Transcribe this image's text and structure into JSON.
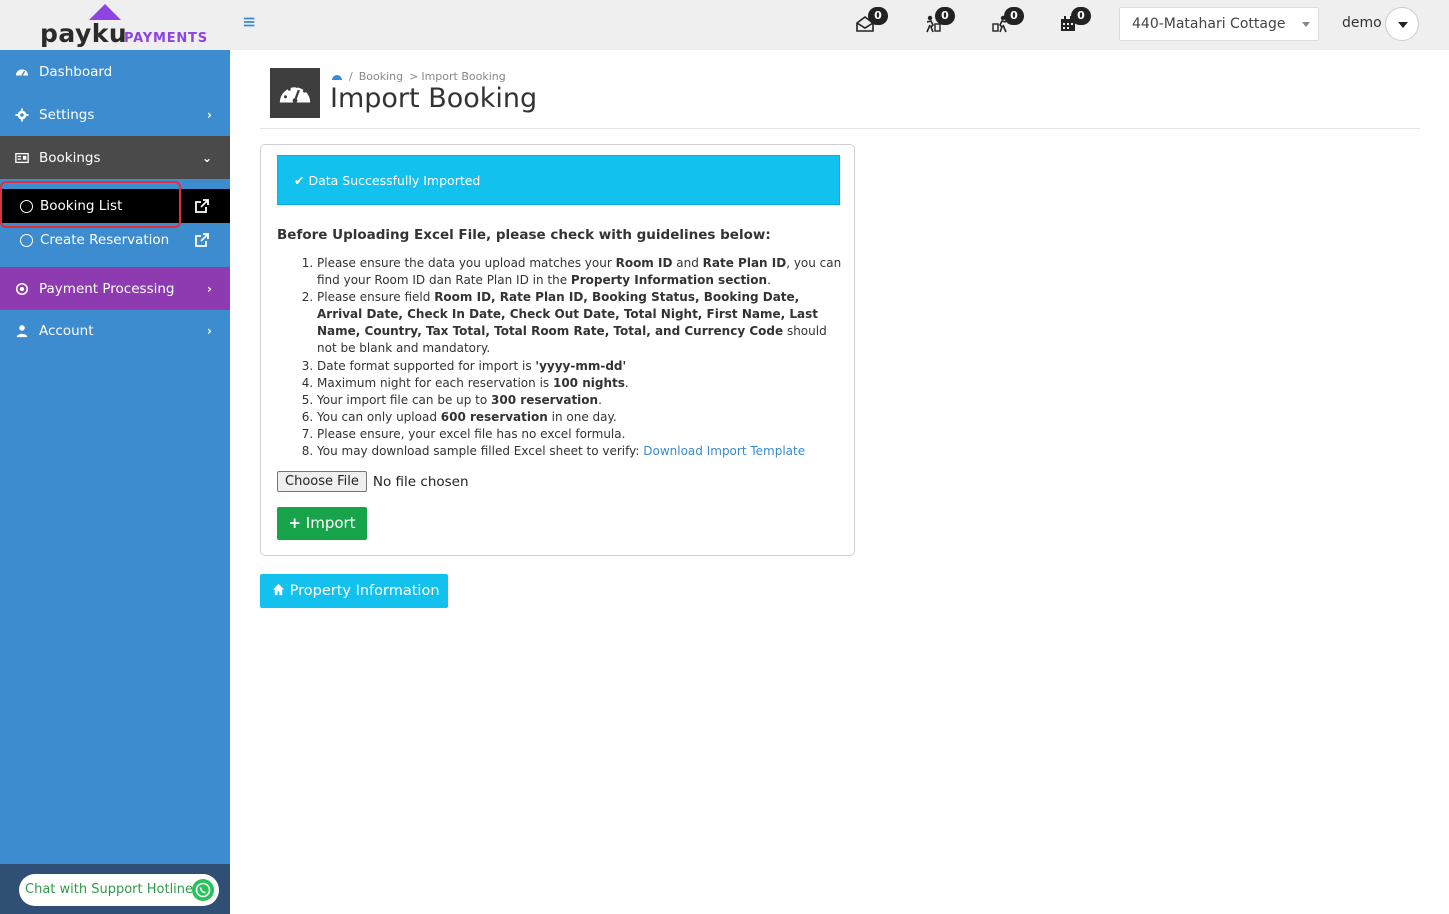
{
  "brand": {
    "name": "payku",
    "subtitle": "PAYMENTS",
    "accent": "#8e44e0"
  },
  "topbar": {
    "notifications": [
      {
        "icon": "envelope-open-icon",
        "count": "0"
      },
      {
        "icon": "check-in-person-icon",
        "count": "0"
      },
      {
        "icon": "check-out-luggage-icon",
        "count": "0"
      },
      {
        "icon": "calendar-icon",
        "count": "0"
      }
    ],
    "property_select": "440-Matahari Cottage",
    "user": "demo"
  },
  "sidebar": {
    "items": [
      {
        "label": "Dashboard",
        "icon": "dashboard-gauge-icon"
      },
      {
        "label": "Settings",
        "icon": "gear-icon"
      },
      {
        "label": "Bookings",
        "icon": "booking-card-icon"
      },
      {
        "label": "Payment Processing",
        "icon": "target-icon"
      },
      {
        "label": "Account",
        "icon": "user-icon"
      }
    ],
    "bookings_sub": [
      {
        "label": "Booking List",
        "icon": "external-link-icon"
      },
      {
        "label": "Create Reservation",
        "icon": "external-link-icon"
      }
    ],
    "hotline": "Chat with Support Hotline"
  },
  "page": {
    "breadcrumb": [
      "Booking",
      "Import Booking"
    ],
    "title": "Import Booking",
    "alert": "Data Successfully Imported",
    "guide_heading": "Before Uploading Excel File, please check with guidelines below:",
    "guide": [
      {
        "parts": [
          [
            "Please ensure the data you upload matches your ",
            false
          ],
          [
            "Room ID",
            true
          ],
          [
            " and ",
            false
          ],
          [
            "Rate Plan ID",
            true
          ],
          [
            ", you can find your Room ID dan Rate Plan ID in the ",
            false
          ],
          [
            "Property Information section",
            true
          ],
          [
            ".",
            false
          ]
        ]
      },
      {
        "parts": [
          [
            "Please ensure field ",
            false
          ],
          [
            "Room ID, Rate Plan ID, Booking Status, Booking Date, Arrival Date, Check In Date, Check Out Date, Total Night, First Name, Last Name, Country, Tax Total, Total Room Rate, Total, and Currency Code",
            true
          ],
          [
            " should not be blank and mandatory.",
            false
          ]
        ]
      },
      {
        "parts": [
          [
            "Date format supported for import is ",
            false
          ],
          [
            "'yyyy-mm-dd'",
            true
          ]
        ]
      },
      {
        "parts": [
          [
            "Maximum night for each reservation is ",
            false
          ],
          [
            "100 nights",
            true
          ],
          [
            ".",
            false
          ]
        ]
      },
      {
        "parts": [
          [
            "Your import file can be up to ",
            false
          ],
          [
            "300 reservation",
            true
          ],
          [
            ".",
            false
          ]
        ]
      },
      {
        "parts": [
          [
            "You can only upload ",
            false
          ],
          [
            "600 reservation",
            true
          ],
          [
            " in one day.",
            false
          ]
        ]
      },
      {
        "parts": [
          [
            "Please ensure, your excel file has no excel formula.",
            false
          ]
        ]
      },
      {
        "parts": [
          [
            "You may download sample filled Excel sheet to verify: ",
            false
          ]
        ],
        "link": "Download Import Template"
      }
    ],
    "file_button": "Choose File",
    "file_status": "No file chosen",
    "import_button": "Import",
    "property_button": "Property Information"
  }
}
